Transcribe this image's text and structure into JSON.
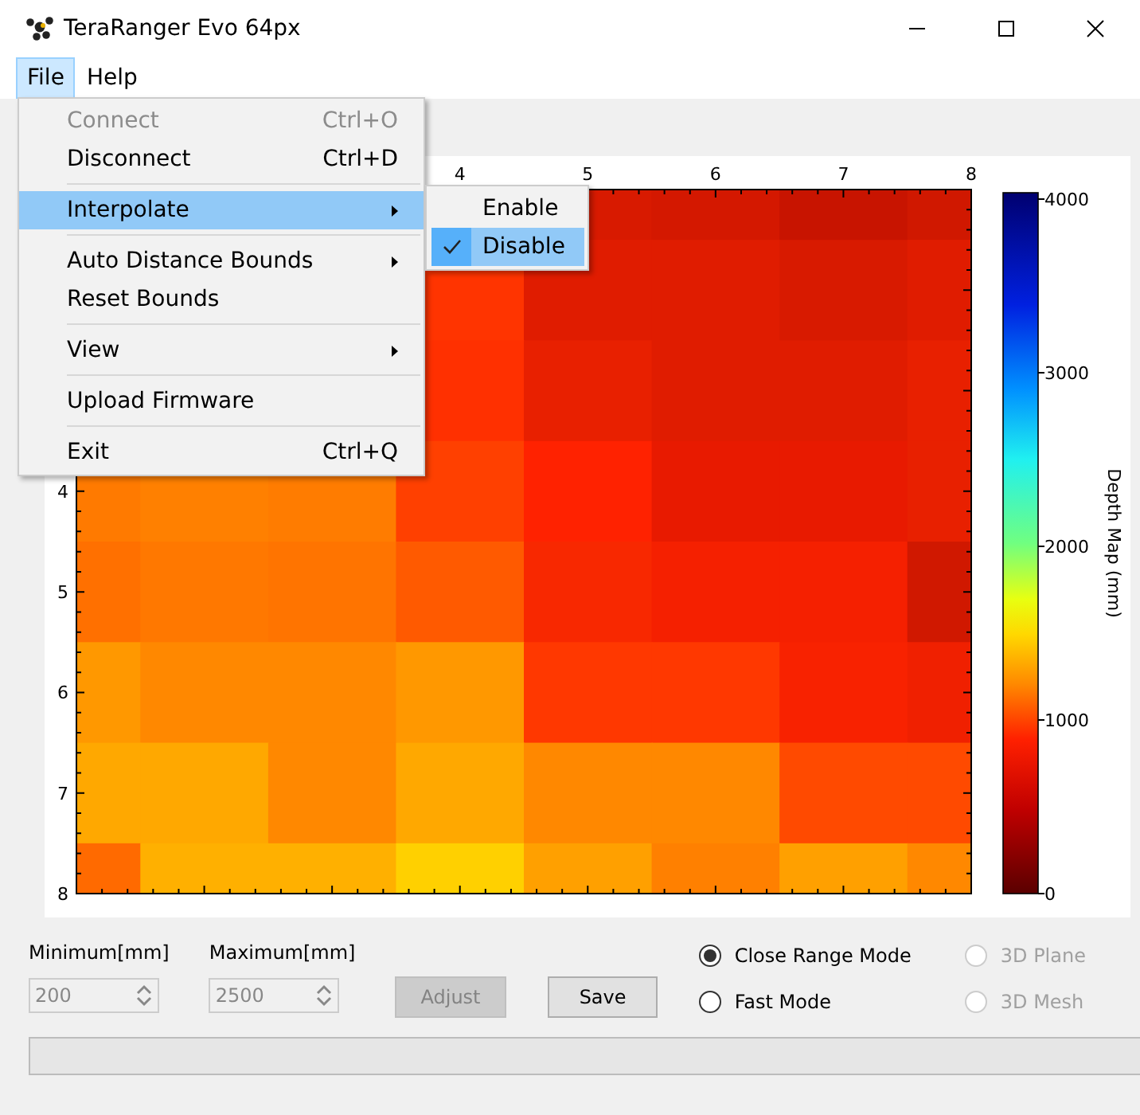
{
  "window": {
    "title": "TeraRanger Evo 64px"
  },
  "menu_bar": [
    {
      "label": "File",
      "selected": true
    },
    {
      "label": "Help",
      "selected": false
    }
  ],
  "file_menu": [
    {
      "kind": "item",
      "label": "Connect",
      "shortcut": "Ctrl+O",
      "disabled": true,
      "selected": false,
      "submenu": false
    },
    {
      "kind": "item",
      "label": "Disconnect",
      "shortcut": "Ctrl+D",
      "disabled": false,
      "selected": false,
      "submenu": false
    },
    {
      "kind": "separator"
    },
    {
      "kind": "item",
      "label": "Interpolate",
      "disabled": false,
      "selected": true,
      "submenu": true
    },
    {
      "kind": "separator"
    },
    {
      "kind": "item",
      "label": "Auto Distance Bounds",
      "disabled": false,
      "selected": false,
      "submenu": true
    },
    {
      "kind": "item",
      "label": "Reset Bounds",
      "disabled": false,
      "selected": false,
      "submenu": false
    },
    {
      "kind": "separator"
    },
    {
      "kind": "item",
      "label": "View",
      "disabled": false,
      "selected": false,
      "submenu": true
    },
    {
      "kind": "separator"
    },
    {
      "kind": "item",
      "label": "Upload Firmware",
      "disabled": false,
      "selected": false,
      "submenu": false
    },
    {
      "kind": "separator"
    },
    {
      "kind": "item",
      "label": "Exit",
      "shortcut": "Ctrl+Q",
      "disabled": false,
      "selected": false,
      "submenu": false
    }
  ],
  "interpolate_menu": [
    {
      "label": "Enable",
      "checked": false,
      "selected": false
    },
    {
      "label": "Disable",
      "checked": true,
      "selected": true
    }
  ],
  "depth_plot": {
    "x_ticks": [
      "4",
      "5",
      "6",
      "7",
      "8"
    ],
    "y_ticks": [
      "4",
      "5",
      "6",
      "7",
      "8"
    ],
    "colorbar": {
      "label": "Depth Map (mm)",
      "ticks": [
        "4000",
        "3000",
        "2000",
        "1000",
        "0"
      ]
    }
  },
  "bounds": [
    {
      "label": "Minimum[mm]",
      "value": "200",
      "disabled": true
    },
    {
      "label": "Maximum[mm]",
      "value": "2500",
      "disabled": true
    }
  ],
  "buttons": [
    {
      "label": "Adjust",
      "disabled": true
    },
    {
      "label": "Save",
      "disabled": false
    }
  ],
  "modes": [
    {
      "label": "Close Range Mode",
      "selected": true,
      "disabled": false
    },
    {
      "label": "Fast Mode",
      "selected": false,
      "disabled": false
    }
  ],
  "views": [
    {
      "label": "3D Plane",
      "selected": false,
      "disabled": true
    },
    {
      "label": "3D Mesh",
      "selected": false,
      "disabled": true
    }
  ],
  "progress": {
    "level": 0
  }
}
